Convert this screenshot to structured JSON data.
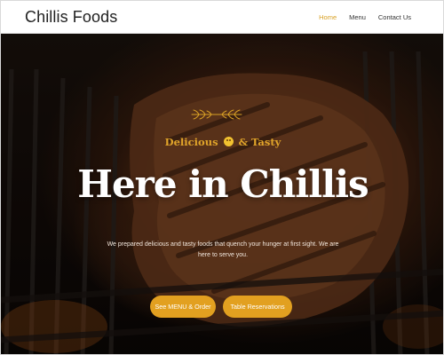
{
  "header": {
    "brand": "Chillis Foods",
    "nav": [
      {
        "label": "Home",
        "active": true
      },
      {
        "label": "Menu",
        "active": false
      },
      {
        "label": "Contact Us",
        "active": false
      }
    ]
  },
  "hero": {
    "tagline_before": "Delicious",
    "tagline_after": "& Tasty",
    "tagline_icon": "smiley-emoji-icon",
    "decoration_icon": "laurel-branch-icon",
    "headline": "Here in Chillis",
    "intro": "We prepared delicious and tasty foods that quench your hunger at first sight. We are here to serve you.",
    "buttons": {
      "menu_label": "See MENU & Order",
      "reserve_label": "Table Reservations"
    }
  },
  "colors": {
    "accent": "#e2a020",
    "nav_active": "#d9a125",
    "headline": "#ffffff"
  }
}
